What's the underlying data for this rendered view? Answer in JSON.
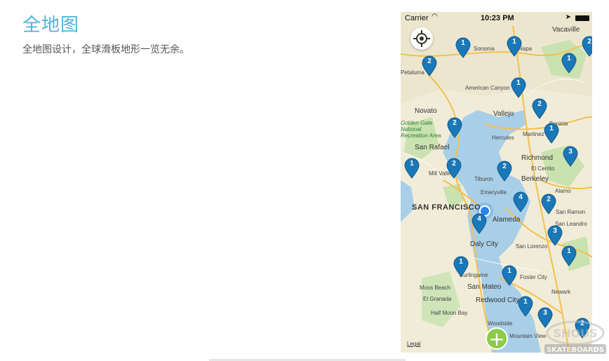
{
  "header": {
    "title": "全地图",
    "subtitle": "全地图设计，全球滑板地形一览无余。"
  },
  "status_bar": {
    "carrier": "Carrier",
    "time": "10:23 PM"
  },
  "map": {
    "legal": "Legal",
    "labels": [
      {
        "text": "SAN FRANCISCO",
        "size": "big"
      },
      {
        "text": "Berkeley",
        "size": "med"
      },
      {
        "text": "Richmond",
        "size": "med"
      },
      {
        "text": "Vallejo",
        "size": "med"
      },
      {
        "text": "Novato",
        "size": "med"
      },
      {
        "text": "Daly City",
        "size": "med"
      },
      {
        "text": "Alameda",
        "size": "med"
      },
      {
        "text": "San Rafael",
        "size": "med"
      },
      {
        "text": "San Mateo",
        "size": "med"
      },
      {
        "text": "Redwood City",
        "size": "med"
      },
      {
        "text": "Vacaville",
        "size": "med"
      },
      {
        "text": "Sonoma",
        "size": "small"
      },
      {
        "text": "Petaluma",
        "size": "small"
      },
      {
        "text": "Napa",
        "size": "small"
      },
      {
        "text": "American Canyon",
        "size": "small"
      },
      {
        "text": "Hercules",
        "size": "small"
      },
      {
        "text": "El Cerrito",
        "size": "small"
      },
      {
        "text": "Tiburon",
        "size": "small"
      },
      {
        "text": "Emeryville",
        "size": "small"
      },
      {
        "text": "Mill Valley",
        "size": "small"
      },
      {
        "text": "San Leandro",
        "size": "small"
      },
      {
        "text": "San Ramon",
        "size": "small"
      },
      {
        "text": "San Lorenzo",
        "size": "small"
      },
      {
        "text": "Burlingame",
        "size": "small"
      },
      {
        "text": "Foster City",
        "size": "small"
      },
      {
        "text": "Moss Beach",
        "size": "small"
      },
      {
        "text": "El Granada",
        "size": "small"
      },
      {
        "text": "Half Moon Bay",
        "size": "small"
      },
      {
        "text": "Woodside",
        "size": "small"
      },
      {
        "text": "Mountain View",
        "size": "small"
      },
      {
        "text": "Newark",
        "size": "small"
      },
      {
        "text": "Alamo",
        "size": "small"
      },
      {
        "text": "Martinez",
        "size": "small"
      },
      {
        "text": "Benicia",
        "size": "small"
      },
      {
        "text": "Golden Gate National Recreation Area",
        "size": "green"
      }
    ],
    "pins": [
      {
        "count": "2",
        "label": "pin-petaluma"
      },
      {
        "count": "1",
        "label": "pin-sonoma"
      },
      {
        "count": "1",
        "label": "pin-napa"
      },
      {
        "count": "2",
        "label": "pin-north-east"
      },
      {
        "count": "1",
        "label": "pin-fairfield"
      },
      {
        "count": "1",
        "label": "pin-american-canyon"
      },
      {
        "count": "2",
        "label": "pin-benicia"
      },
      {
        "count": "2",
        "label": "pin-novato"
      },
      {
        "count": "1",
        "label": "pin-martinez"
      },
      {
        "count": "3",
        "label": "pin-walnut-creek"
      },
      {
        "count": "1",
        "label": "pin-point-reyes"
      },
      {
        "count": "2",
        "label": "pin-mill-valley"
      },
      {
        "count": "2",
        "label": "pin-richmond"
      },
      {
        "count": "4",
        "label": "pin-oakland"
      },
      {
        "count": "2",
        "label": "pin-san-ramon"
      },
      {
        "count": "4",
        "label": "pin-san-francisco"
      },
      {
        "count": "3",
        "label": "pin-hayward"
      },
      {
        "count": "1",
        "label": "pin-union-city"
      },
      {
        "count": "1",
        "label": "pin-pacifica"
      },
      {
        "count": "1",
        "label": "pin-san-mateo"
      },
      {
        "count": "1",
        "label": "pin-palo-alto"
      },
      {
        "count": "3",
        "label": "pin-mountain-view"
      },
      {
        "count": "2",
        "label": "pin-south-east"
      }
    ]
  },
  "watermark": {
    "text": "SKATEBOARDS"
  },
  "colors": {
    "accent": "#4fb3de",
    "pin": "#1a78b8",
    "add": "#8bcb4a",
    "water": "#a9cfe8",
    "land": "#f1ecd8"
  }
}
